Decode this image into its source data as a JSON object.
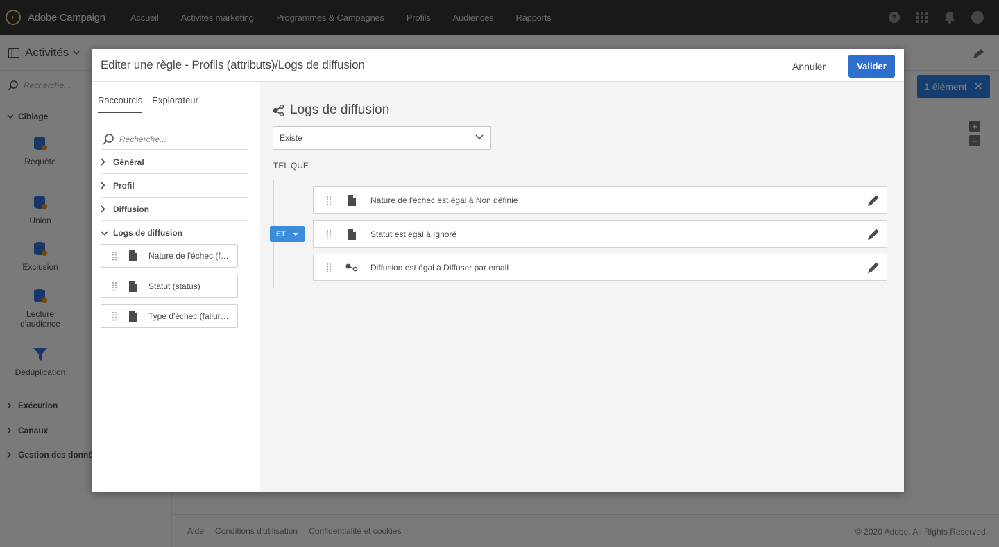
{
  "app": {
    "brand": "Adobe Campaign",
    "nav": [
      "Accueil",
      "Activités marketing",
      "Programmes & Campagnes",
      "Profils",
      "Audiences",
      "Rapports"
    ]
  },
  "background": {
    "title": "Activités",
    "search_placeholder": "Recherche...",
    "sections": {
      "ciblage": "Ciblage",
      "execution": "Exécution",
      "canaux": "Canaux",
      "gestion": "Gestion des données"
    },
    "activities": [
      "Requête",
      "Union",
      "Exclusion",
      "Lecture d'audience",
      "Déduplication"
    ],
    "selection_pill": "1 élément",
    "footer": [
      "Aide",
      "Conditions d'utilisation",
      "Confidentialité et cookies"
    ],
    "copyright": "© 2020 Adobe. All Rights Reserved."
  },
  "modal": {
    "title": "Editer une règle - Profils (attributs)/Logs de diffusion",
    "cancel": "Annuler",
    "ok": "Valider",
    "tabs": [
      "Raccourcis",
      "Explorateur"
    ],
    "search_placeholder": "Recherche...",
    "tree": [
      "Général",
      "Profil",
      "Diffusion",
      "Logs de diffusion"
    ],
    "fields": [
      "Nature de l'échec (failureReason)",
      "Statut (status)",
      "Type d'échec (failureType)"
    ],
    "right": {
      "title": "Logs de diffusion",
      "select_value": "Existe",
      "tel_que": "TEL QUE",
      "operator": "ET",
      "conditions": [
        {
          "text": "Nature de l'échec est égal à Non définie",
          "icon": "document-icon"
        },
        {
          "text": "Statut est égal à Ignoré",
          "icon": "document-icon"
        },
        {
          "text": "Diffusion est égal à Diffuser par email",
          "icon": "link-node-icon"
        }
      ]
    }
  }
}
